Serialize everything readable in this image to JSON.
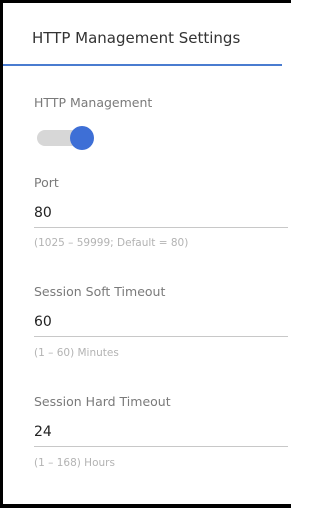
{
  "header": {
    "title": "HTTP Management Settings"
  },
  "http_management": {
    "label": "HTTP Management",
    "enabled": true
  },
  "port": {
    "label": "Port",
    "value": "80",
    "hint": "(1025 – 59999; Default = 80)"
  },
  "session_soft_timeout": {
    "label": "Session Soft Timeout",
    "value": "60",
    "hint": "(1 – 60) Minutes"
  },
  "session_hard_timeout": {
    "label": "Session Hard Timeout",
    "value": "24",
    "hint": "(1 – 168) Hours"
  },
  "colors": {
    "accent": "#3e6fd6",
    "toggle_track": "#d7d7d7",
    "label": "#7a7a7a",
    "hint": "#b3b3b3"
  },
  "icons": {
    "toggle": "toggle-switch-icon"
  }
}
